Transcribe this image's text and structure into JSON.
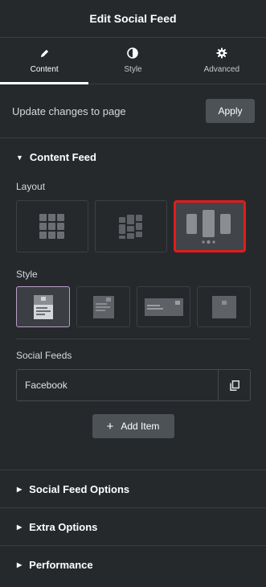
{
  "header": {
    "title": "Edit Social Feed"
  },
  "tabs": [
    {
      "label": "Content",
      "icon": "pencil-icon",
      "active": true
    },
    {
      "label": "Style",
      "icon": "contrast-icon",
      "active": false
    },
    {
      "label": "Advanced",
      "icon": "gear-icon",
      "active": false
    }
  ],
  "update": {
    "text": "Update changes to page",
    "apply_label": "Apply"
  },
  "content_feed": {
    "title": "Content Feed",
    "layout_label": "Layout",
    "layout_options": [
      "grid",
      "masonry",
      "carousel"
    ],
    "layout_selected": "carousel",
    "style_label": "Style",
    "style_options": [
      "card-vertical",
      "card-overlay",
      "card-horizontal",
      "card-image-only"
    ],
    "style_selected": "card-vertical",
    "social_feeds_label": "Social Feeds",
    "feeds": [
      {
        "name": "Facebook"
      }
    ],
    "add_item_label": "Add Item"
  },
  "sections": [
    {
      "title": "Social Feed Options"
    },
    {
      "title": "Extra Options"
    },
    {
      "title": "Performance"
    }
  ],
  "colors": {
    "background": "#26292c",
    "selection_highlight": "#e21b1b",
    "button": "#4d5257",
    "style_selected_border": "#b89ec9"
  }
}
